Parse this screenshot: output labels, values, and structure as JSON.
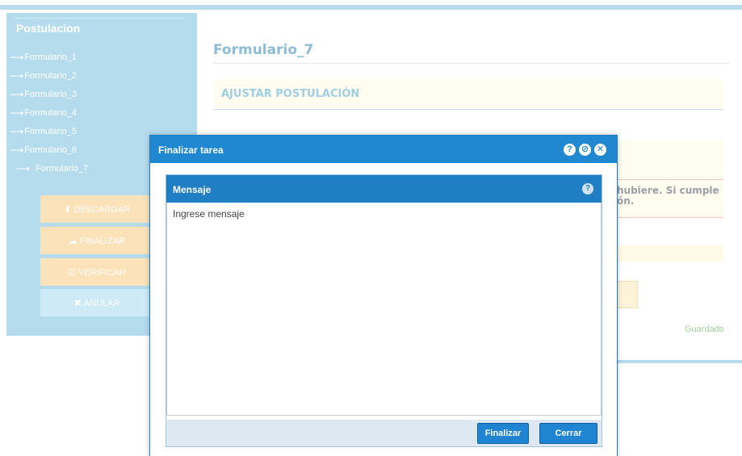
{
  "sidebar": {
    "title": "Postulacion",
    "arrow": "⟶",
    "items": [
      {
        "label": "Formulario_1"
      },
      {
        "label": "Formulario_2"
      },
      {
        "label": "Formulario_3"
      },
      {
        "label": "Formulario_4"
      },
      {
        "label": "Formulario_5"
      },
      {
        "label": "Formulario_6"
      },
      {
        "label": "Formulario_7"
      }
    ],
    "buttons": {
      "descargar": "DESCARGAR",
      "finalizar": "FINALIZAR",
      "verificar": "VERIFICAR",
      "anular": "ANULAR"
    }
  },
  "main": {
    "title": "Formulario_7",
    "section_title": "AJUSTAR POSTULACIÓN",
    "warning_line1": "hubiere. Si cumple",
    "warning_line2": "ón.",
    "status": "Guardado"
  },
  "dialog": {
    "title": "Finalizar tarea",
    "panel_title": "Mensaje",
    "message_placeholder": "Ingrese mensaje",
    "message_value": "",
    "ok_label": "Finalizar",
    "cancel_label": "Cerrar",
    "help_glyph": "?",
    "block_glyph": "⊘",
    "close_glyph": "✕"
  },
  "colors": {
    "accent": "#1f88d0",
    "sidebar": "#b5dcec",
    "warning_button": "#fbe2b8",
    "status_ok": "#9ed19e"
  }
}
